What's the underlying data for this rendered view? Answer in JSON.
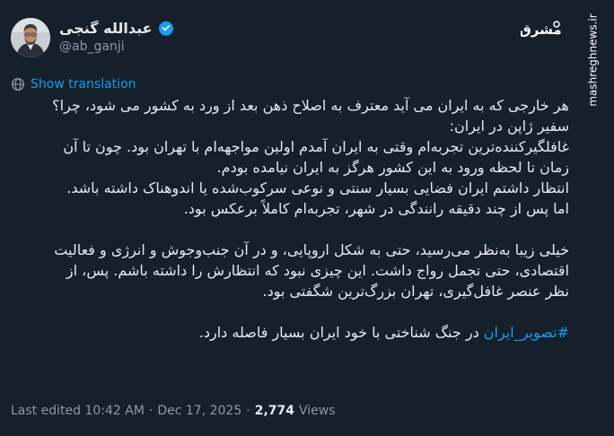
{
  "author": {
    "display_name": "عبدالله گنجی",
    "handle": "@ab_ganji"
  },
  "icons": {
    "avatar": "profile-photo",
    "verified": "verified-badge-icon",
    "translate": "globe-translate-icon",
    "logo": "mashregh-logo"
  },
  "logo": {
    "text": "مشرق"
  },
  "watermark": "mashreghnews.ir",
  "translate": {
    "label": "Show translation"
  },
  "tweet": {
    "line1": "هر خارجی که به ایران می آید معترف به اصلاح ذهن بعد از ورد به کشور می شود، چرا؟",
    "line2": "سفیر ژاپن در ایران:",
    "line3": "غافلگیرکننده‌ترین تجربه‌ام وقتی به ایران آمدم اولین مواجهه‌ام با تهران بود. چون تا آن",
    "line4": "زمان تا لحظه ورود به این کشور هرگز به ایران نیامده بودم.",
    "line5": "انتظار داشتم ایران فضایی بسیار سنتی و نوعی سرکوب‌شده یا اندوهناک داشته باشد.",
    "line6": "اما پس از چند دقیقه رانندگی در شهر، تجربه‌ام کاملاً برعکس بود.",
    "line7": "خیلی زیبا به‌نظر می‌رسید، حتی به شکل اروپایی، و در آن جنب‌وجوش و انرژی و فعالیت",
    "line8": "اقتصادی، حتی تجمل رواج داشت. این چیزی نبود که انتظارش را داشته باشم. پس، از",
    "line9": "نظر عنصر غافل‌گیری، تهران بزرگ‌ترین شگفتی بود.",
    "hashtag": "#تصویر_ایران",
    "line10_rest": " در جنگ شناختی با خود ایران بسیار فاصله دارد."
  },
  "meta": {
    "edited": "Last edited 10:42 AM",
    "separator": "·",
    "date": "Dec 17, 2025",
    "views_count": "2,774",
    "views_label": "Views"
  },
  "colors": {
    "background": "#15202b",
    "text": "#e7e9ea",
    "secondary": "#8b98a5",
    "accent": "#1d9bf0"
  }
}
